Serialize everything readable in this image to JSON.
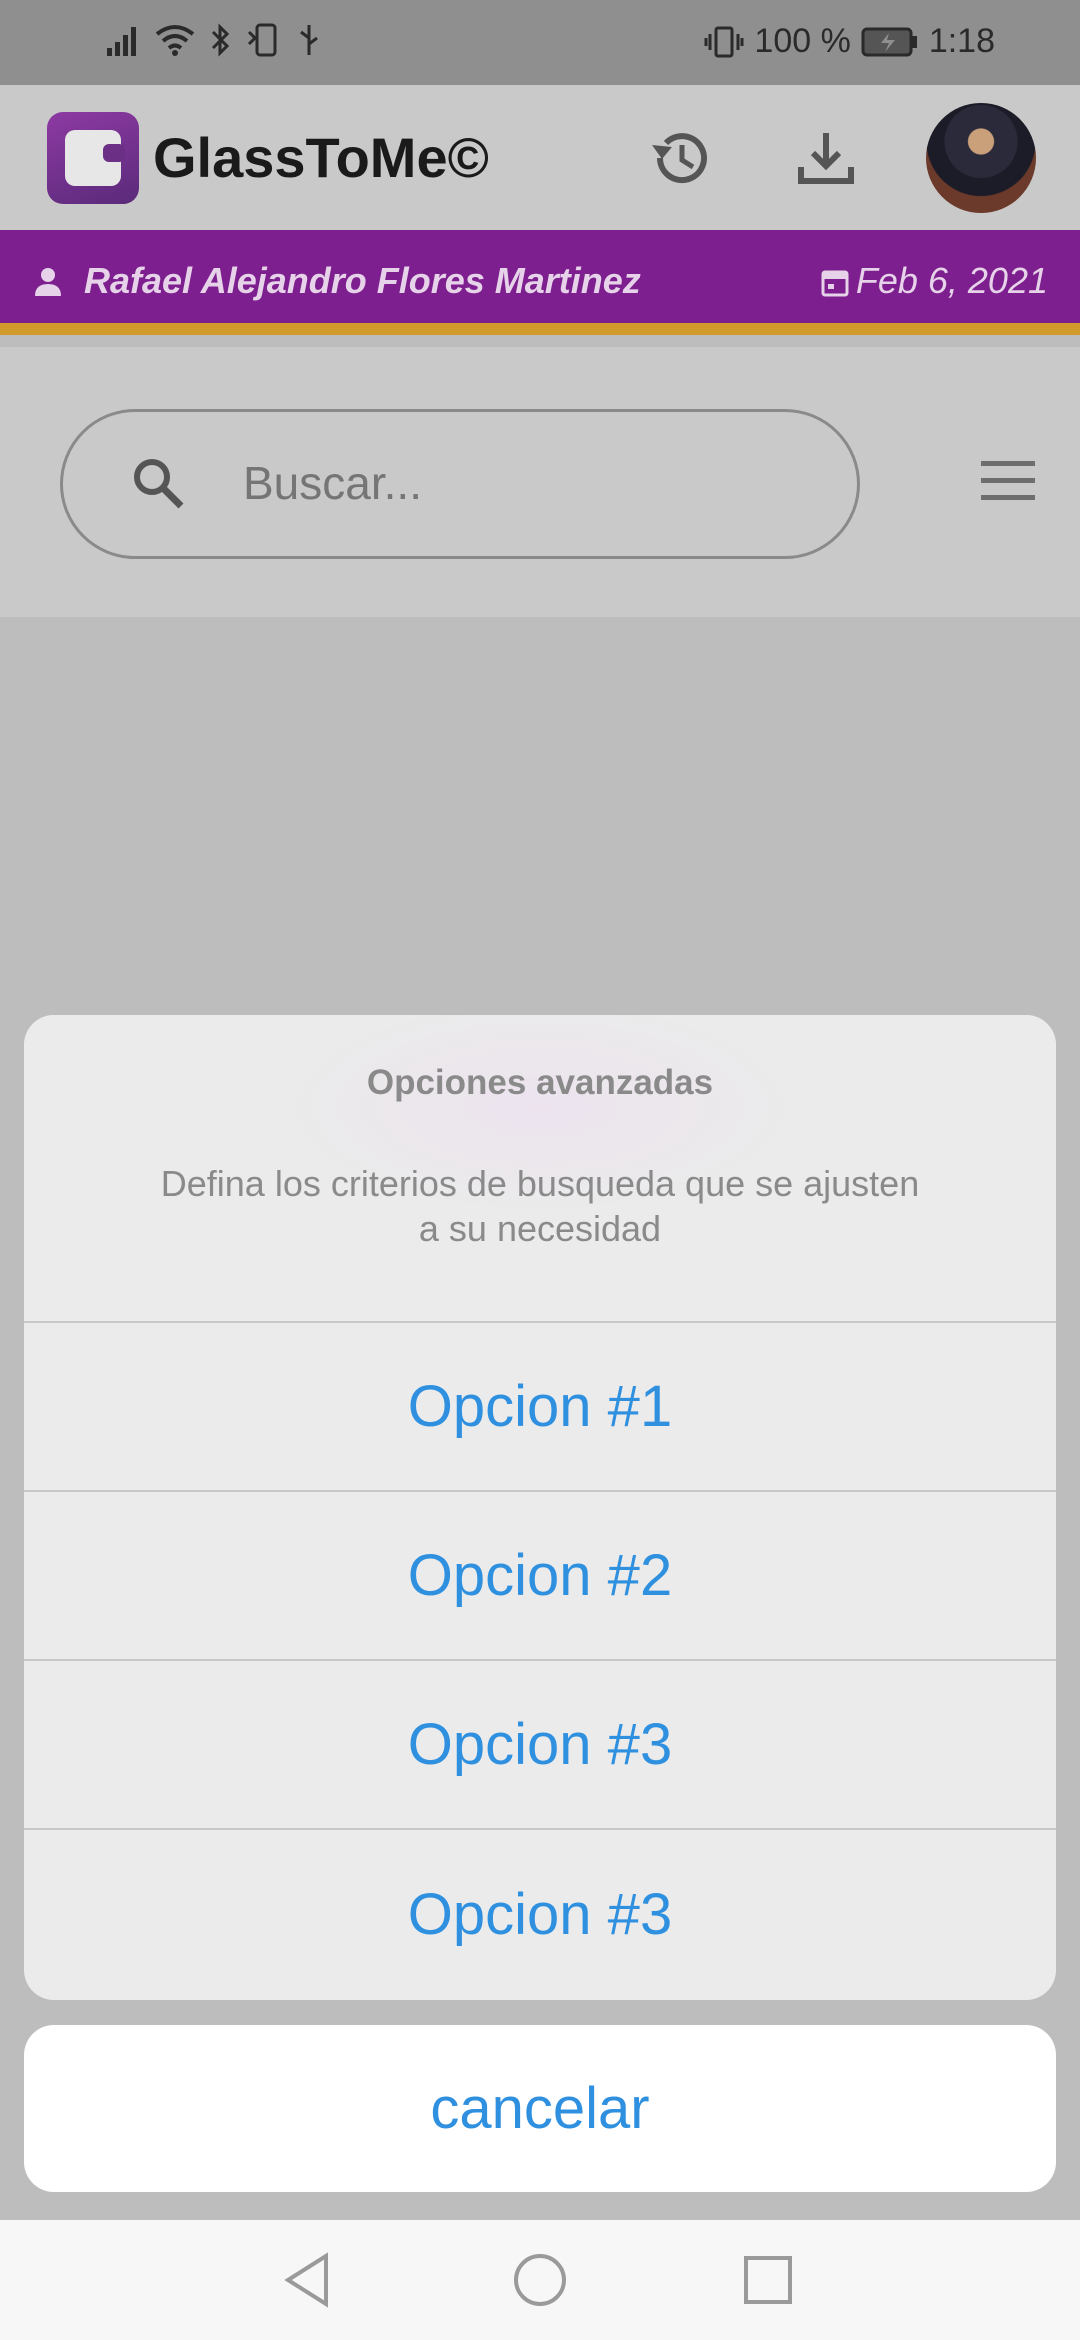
{
  "status_bar": {
    "battery": "100 %",
    "time": "1:18"
  },
  "app_bar": {
    "title": "GlassToMe©",
    "icons": [
      "history-icon",
      "download-icon",
      "avatar"
    ]
  },
  "user_bar": {
    "user_name": "Rafael Alejandro Flores Martinez",
    "date": "Feb 6, 2021"
  },
  "search": {
    "placeholder": "Buscar..."
  },
  "action_sheet": {
    "title": "Opciones avanzadas",
    "message": "Defina los criterios de busqueda que se ajusten a su necesidad",
    "options": [
      "Opcion #1",
      "Opcion #2",
      "Opcion #3",
      "Opcion #3"
    ],
    "cancel_label": "cancelar"
  },
  "colors": {
    "brand_purple": "#7d1f8e",
    "accent_gold": "#d19a2a",
    "action_blue": "#2f90e0"
  }
}
